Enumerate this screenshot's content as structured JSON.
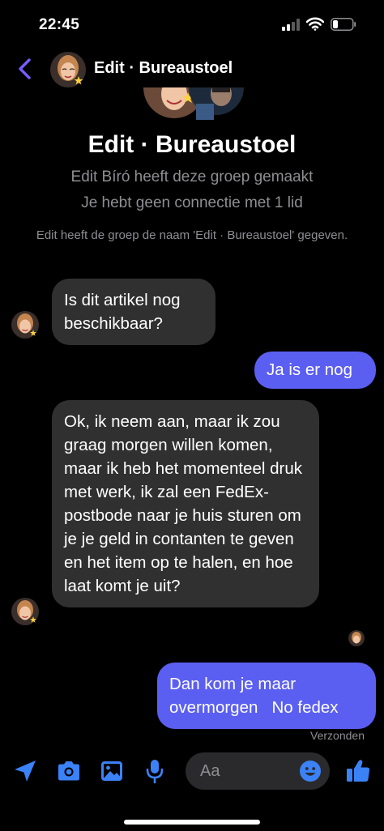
{
  "status_bar": {
    "time": "22:45"
  },
  "header": {
    "title": "Edit · Bureaustoel",
    "back_icon": "chevron-left-icon"
  },
  "group_info": {
    "name": "Edit · Bureaustoel",
    "created_by": "Edit Bíró heeft deze groep gemaakt",
    "connection": "Je hebt geen connectie met 1 lid",
    "rename_notice": "Edit heeft de groep de naam 'Edit · Bureaustoel' gegeven."
  },
  "messages": [
    {
      "direction": "incoming",
      "text": "Is dit artikel nog beschikbaar?"
    },
    {
      "direction": "outgoing",
      "text": "Ja is er nog"
    },
    {
      "direction": "incoming",
      "text": "Ok, ik neem aan, maar ik zou graag morgen willen komen, maar ik heb het momenteel druk met werk, ik zal een FedEx-postbode naar je huis sturen om je je geld in contanten te geven en het item op te halen, en hoe laat komt je uit?"
    },
    {
      "direction": "outgoing",
      "text": "Dan kom je maar overmorgen   No fedex"
    }
  ],
  "sent_status": "Verzonden",
  "composer": {
    "placeholder": "Aa",
    "icons": [
      "location-arrow-icon",
      "camera-icon",
      "image-icon",
      "microphone-icon",
      "emoji-icon",
      "thumbs-up-icon"
    ]
  },
  "colors": {
    "accent": "#7b5cff",
    "outgoing_bubble": "#5b5ff1",
    "incoming_bubble": "#303030",
    "composer_icon": "#3b82f6",
    "background": "#000000"
  }
}
